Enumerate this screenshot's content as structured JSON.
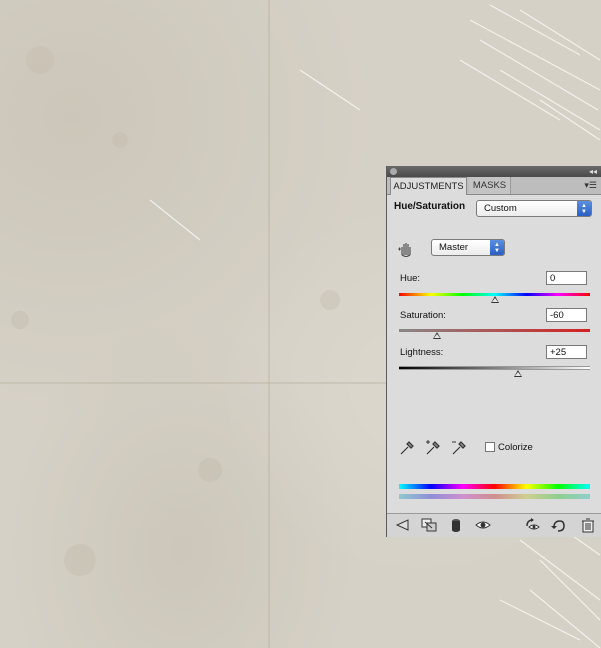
{
  "panel": {
    "tabs": [
      {
        "label": "ADJUSTMENTS",
        "active": true
      },
      {
        "label": "MASKS",
        "active": false
      }
    ],
    "adjustment_title": "Hue/Saturation",
    "preset": {
      "selected": "Custom"
    },
    "channel": {
      "selected": "Master"
    },
    "sliders": {
      "hue": {
        "label": "Hue:",
        "value": "0",
        "position": 0.5
      },
      "saturation": {
        "label": "Saturation:",
        "value": "-60",
        "position": 0.2
      },
      "lightness": {
        "label": "Lightness:",
        "value": "+25",
        "position": 0.625
      }
    },
    "colorize": {
      "label": "Colorize",
      "checked": false
    },
    "icons": {
      "titlebar": [
        "close-icon",
        "collapse-icon"
      ],
      "tab_menu": "panel-menu-icon",
      "tool": "targeted-adjustment-hand-icon",
      "eyedroppers": [
        "eyedropper-icon",
        "eyedropper-add-icon",
        "eyedropper-subtract-icon"
      ],
      "footer": [
        "back-arrow-icon",
        "clip-to-layer-icon",
        "visibility-circle-icon",
        "eye-icon",
        "view-previous-icon",
        "reset-icon",
        "trash-icon"
      ]
    },
    "colors": {
      "panel_bg": "#dcdcdc",
      "select_arrow": "#2a5fc4"
    }
  }
}
